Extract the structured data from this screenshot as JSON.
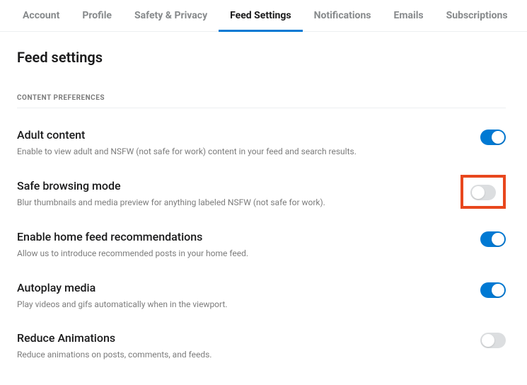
{
  "tabs": {
    "account": "Account",
    "profile": "Profile",
    "safety": "Safety & Privacy",
    "feed": "Feed Settings",
    "notifications": "Notifications",
    "emails": "Emails",
    "subscriptions": "Subscriptions"
  },
  "page_title": "Feed settings",
  "section_label": "CONTENT PREFERENCES",
  "settings": {
    "adult": {
      "title": "Adult content",
      "desc": "Enable to view adult and NSFW (not safe for work) content in your feed and search results.",
      "on": true
    },
    "safe": {
      "title": "Safe browsing mode",
      "desc": "Blur thumbnails and media preview for anything labeled NSFW (not safe for work).",
      "on": false,
      "highlighted": true
    },
    "recs": {
      "title": "Enable home feed recommendations",
      "desc": "Allow us to introduce recommended posts in your home feed.",
      "on": true
    },
    "autoplay": {
      "title": "Autoplay media",
      "desc": "Play videos and gifs automatically when in the viewport.",
      "on": true
    },
    "reduce": {
      "title": "Reduce Animations",
      "desc": "Reduce animations on posts, comments, and feeds.",
      "on": false
    }
  }
}
